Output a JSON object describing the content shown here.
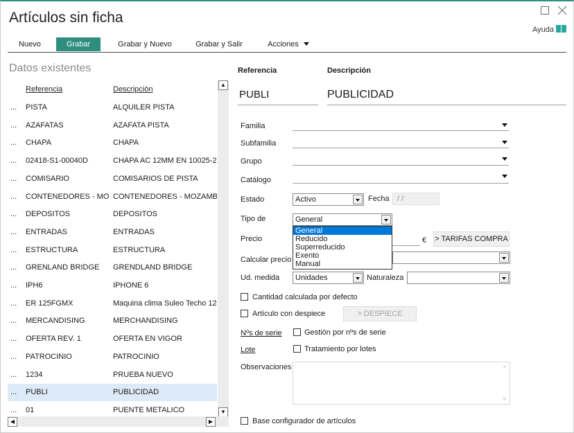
{
  "window": {
    "title": "Artículos sin ficha",
    "help_label": "Ayuda"
  },
  "toolbar": {
    "new_label": "Nuevo",
    "save_label": "Grabar",
    "save_new_label": "Grabar y Nuevo",
    "save_exit_label": "Grabar y Salir",
    "actions_label": "Acciones",
    "accent_color": "#2f8d80"
  },
  "left": {
    "heading": "Datos existentes",
    "col_ref": "Referencia",
    "col_desc": "Descripción",
    "rows": [
      {
        "dots": "...",
        "ref": "PISTA",
        "desc": "ALQUILER PISTA"
      },
      {
        "dots": "...",
        "ref": "AZAFATAS",
        "desc": "AZAFATA PISTA"
      },
      {
        "dots": "...",
        "ref": "CHAPA",
        "desc": "CHAPA"
      },
      {
        "dots": "...",
        "ref": "02418-S1-00040D",
        "desc": "CHAPA AC 12MM EN 10025-2"
      },
      {
        "dots": "...",
        "ref": "COMISARIO",
        "desc": "COMISARIOS DE PISTA"
      },
      {
        "dots": "...",
        "ref": "CONTENEDORES - MOZ",
        "desc": "CONTENEDORES - MOZAMBIC"
      },
      {
        "dots": "...",
        "ref": "DEPOSITOS",
        "desc": "DEPOSITOS"
      },
      {
        "dots": "...",
        "ref": "ENTRADAS",
        "desc": "ENTRADAS"
      },
      {
        "dots": "...",
        "ref": "ESTRUCTURA",
        "desc": "ESTRUCTURA"
      },
      {
        "dots": "...",
        "ref": "GRENLAND BRIDGE",
        "desc": "GRENDLAND BRIDGE"
      },
      {
        "dots": "...",
        "ref": "IPH6",
        "desc": "IPHONE 6"
      },
      {
        "dots": "...",
        "ref": "ER 125FGMX",
        "desc": "Maquina clima Suleo Techo 12"
      },
      {
        "dots": "...",
        "ref": "MERCANDISING",
        "desc": "MERCHANDISING"
      },
      {
        "dots": "...",
        "ref": "OFERTA REV. 1",
        "desc": "OFERTA EN VIGOR"
      },
      {
        "dots": "...",
        "ref": "PATROCINIO",
        "desc": "PATROCINIO"
      },
      {
        "dots": "...",
        "ref": "1234",
        "desc": "PRUEBA NUEVO"
      },
      {
        "dots": "...",
        "ref": "PUBLI",
        "desc": "PUBLICIDAD",
        "selected": true
      },
      {
        "dots": "...",
        "ref": "01",
        "desc": "PUENTE METALICO"
      }
    ]
  },
  "form": {
    "ref_label": "Referencia",
    "desc_label": "Descripción",
    "ref_value": "PUBLI",
    "desc_value": "PUBLICIDAD",
    "familia_label": "Familia",
    "subfamilia_label": "Subfamilia",
    "grupo_label": "Grupo",
    "catalogo_label": "Catálogo",
    "estado_label": "Estado",
    "estado_value": "Activo",
    "fecha_label": "Fecha",
    "fecha_value": "/ /",
    "tipo_label": "Tipo de",
    "tipo_value": "General",
    "tipo_options": [
      "General",
      "Reducido",
      "Superreducido",
      "Exento",
      "Manual"
    ],
    "precio_label": "Precio",
    "currency": "€",
    "tarifas_button": "> TARIFAS COMPRA",
    "calcular_label": "Calcular precio",
    "ud_label": "Ud. medida",
    "ud_value": "Unidades",
    "naturaleza_label": "Naturaleza",
    "cantidad_label": "Cantidad calculada por defecto",
    "despiece_check_label": "Artículo con despiece",
    "despiece_button": "> DESPIECE",
    "series_link": "Nºs de serie",
    "series_check_label": "Gestión por nºs de serie",
    "lote_link": "Lote",
    "lote_check_label": "Tratamiento por lotes",
    "obs_label": "Observaciones",
    "base_label": "Base configurador de artículos"
  }
}
